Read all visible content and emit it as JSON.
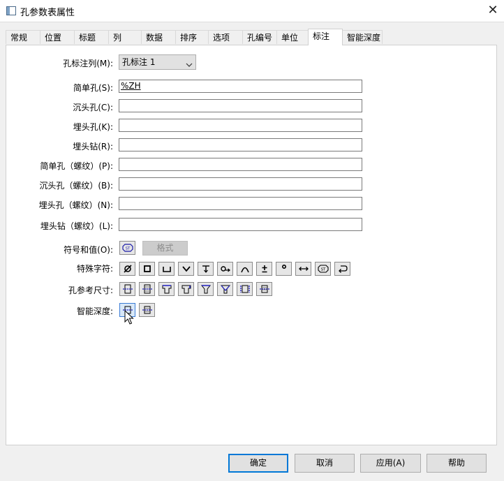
{
  "window": {
    "title": "孔参数表属性",
    "close_glyph": "✕"
  },
  "tabs": [
    "常规",
    "位置",
    "标题",
    "列",
    "数据",
    "排序",
    "选项",
    "孔编号",
    "单位",
    "标注",
    "智能深度"
  ],
  "active_tab": "标注",
  "annotation_column": {
    "label": "孔标注列(M):",
    "value": "孔标注 1"
  },
  "fields": [
    {
      "label": "简单孔(S):",
      "value": "%ZH"
    },
    {
      "label": "沉头孔(C):",
      "value": ""
    },
    {
      "label": "埋头孔(K):",
      "value": ""
    },
    {
      "label": "埋头钻(R):",
      "value": ""
    },
    {
      "label": "简单孔（螺纹）(P):",
      "value": ""
    },
    {
      "label": "沉头孔（螺纹）(B):",
      "value": ""
    },
    {
      "label": "埋头孔（螺纹）(N):",
      "value": ""
    },
    {
      "label": "埋头钻（螺纹）(L):",
      "value": ""
    }
  ],
  "symbols_values": {
    "label": "符号和值(O):",
    "format_button": "格式"
  },
  "special_chars": {
    "label": "特殊字符:",
    "icons": [
      "diameter-icon",
      "square-icon",
      "counterbore-icon",
      "countersink-icon",
      "depth-icon",
      "spotface-icon",
      "arc-length-icon",
      "plus-minus-icon",
      "degree-icon",
      "arrow-both-icon",
      "st-symbol-icon",
      "return-icon"
    ]
  },
  "hole_ref_dims": {
    "label": "孔参考尺寸:",
    "icons": [
      "hole-diameter-icon",
      "hole-thread-icon",
      "counterbore-diameter-icon",
      "counterbore-depth-icon",
      "countersink-diameter-icon",
      "countersink-angle-icon",
      "hole-depth-icon",
      "thread-depth-icon"
    ]
  },
  "smart_depth": {
    "label": "智能深度:",
    "icons": [
      "smart-depth-hole-icon",
      "smart-depth-thread-icon"
    ]
  },
  "footer": {
    "ok": "确定",
    "cancel": "取消",
    "apply": "应用(A)",
    "help": "帮助"
  }
}
